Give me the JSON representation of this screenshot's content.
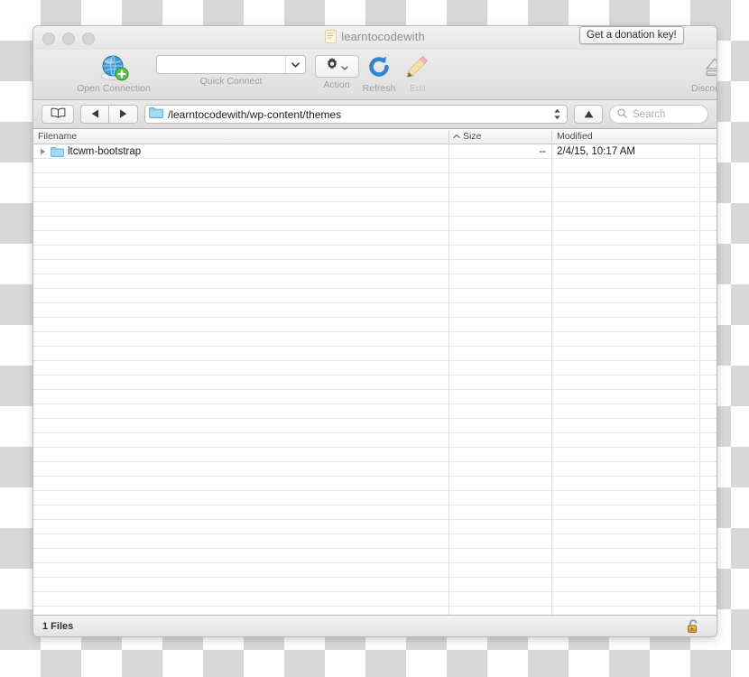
{
  "window": {
    "title": "learntocodewith",
    "title_icon": "app-document-icon",
    "traffic_lights": [
      "close-button",
      "minimize-button",
      "zoom-button"
    ]
  },
  "donation": {
    "label": "Get a donation key!"
  },
  "toolbar": {
    "items": [
      {
        "name": "open-connection",
        "label": "Open Connection",
        "icon": "globe-plus-icon",
        "enabled": true
      },
      {
        "name": "action",
        "label": "Action",
        "icon": "gear-icon",
        "enabled": true
      },
      {
        "name": "refresh",
        "label": "Refresh",
        "icon": "refresh-icon",
        "enabled": true
      },
      {
        "name": "edit",
        "label": "Edit",
        "icon": "pencil-icon",
        "enabled": false
      },
      {
        "name": "disconnect",
        "label": "Disconnect",
        "icon": "eject-icon",
        "enabled": true
      }
    ],
    "quick_connect": {
      "label": "Quick Connect",
      "value": "",
      "placeholder": ""
    }
  },
  "navbar": {
    "bookmark_icon": "book-icon",
    "back_icon": "triangle-left-icon",
    "forward_icon": "triangle-right-icon",
    "path_icon": "folder-icon",
    "path": "/learntocodewith/wp-content/themes",
    "stepper_icon": "stepper-updown-icon",
    "up_icon": "triangle-up-icon",
    "search": {
      "icon": "search-icon",
      "value": "",
      "placeholder": "Search"
    }
  },
  "columns": {
    "filename": "Filename",
    "size": "Size",
    "modified": "Modified",
    "sort_indicator": "chevron-up-icon"
  },
  "files": [
    {
      "name": "ltcwm-bootstrap",
      "size": "--",
      "modified": "2/4/15, 10:17 AM",
      "icon": "folder-icon",
      "disclosure": "triangle-right-icon"
    }
  ],
  "empty_row_count": 31,
  "statusbar": {
    "text": "1 Files",
    "lock_icon": "padlock-icon"
  },
  "colors": {
    "folder_blue": "#7cc7e8",
    "accent_blue": "#2e7fc4",
    "window_chrome": "#ececec",
    "lock_gold": "#c89334"
  }
}
